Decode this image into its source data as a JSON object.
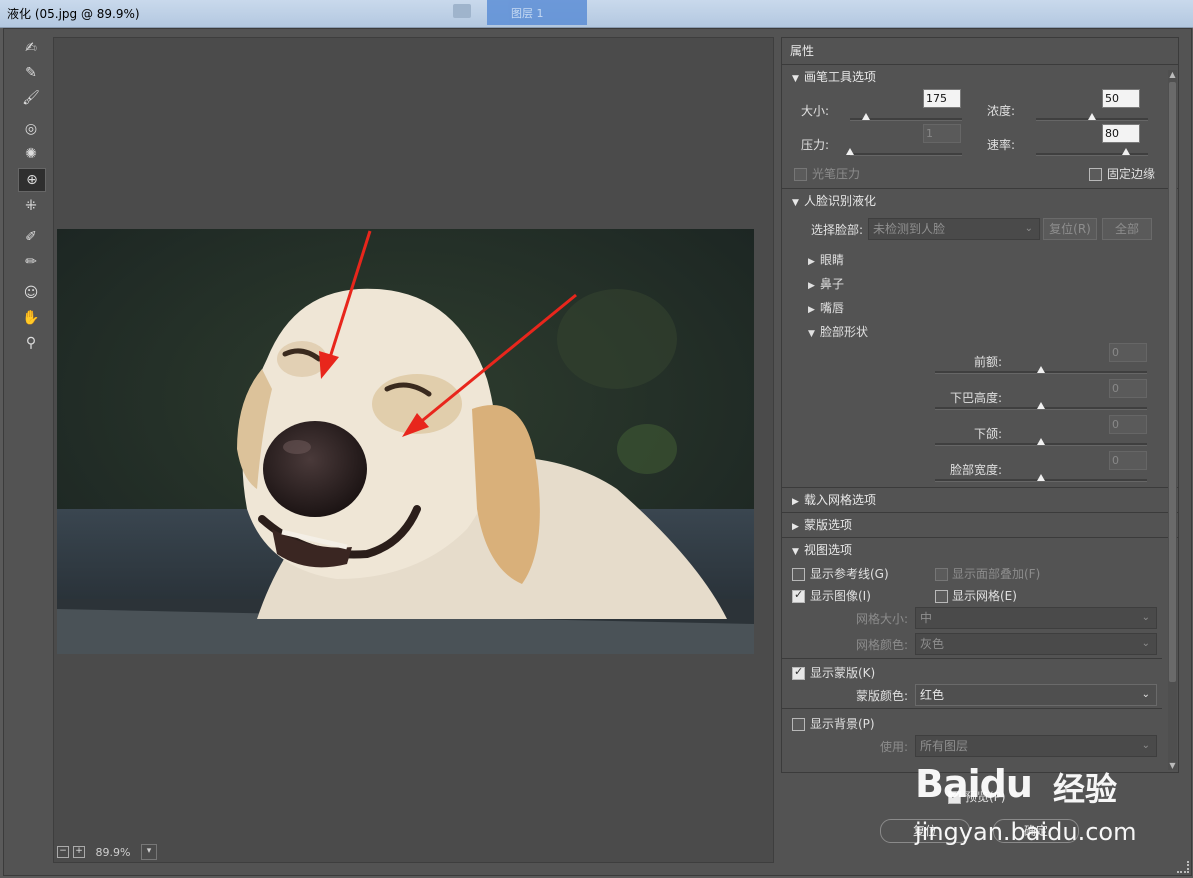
{
  "window": {
    "title": "液化 (05.jpg @ 89.9%)",
    "taskbar_hint": "图层 1"
  },
  "toolbar": {
    "icons": [
      "forward-warp-icon",
      "reconstruct-icon",
      "smooth-icon",
      "twirl-icon",
      "pucker-icon",
      "bloat-icon",
      "push-left-icon",
      "freeze-mask-icon",
      "thaw-mask-icon",
      "face-tool-icon",
      "hand-icon",
      "zoom-icon"
    ],
    "active": "bloat-icon"
  },
  "canvas": {
    "zoom": "89.9%",
    "zoom_out": "−",
    "zoom_in": "+"
  },
  "properties": {
    "header": "属性",
    "brush": {
      "title": "画笔工具选项",
      "size_label": "大小:",
      "size_value": "175",
      "size_level": 0.14,
      "density_label": "浓度:",
      "density_value": "50",
      "density_level": 0.5,
      "pressure_label": "压力:",
      "pressure_value": "1",
      "pressure_level": 0.0,
      "rate_label": "速率:",
      "rate_value": "80",
      "rate_level": 0.8,
      "stylus_label": "光笔压力",
      "pin_edges_label": "固定边缘"
    },
    "face": {
      "title": "人脸识别液化",
      "select_face_label": "选择脸部:",
      "select_face_value": "未检测到人脸",
      "reset_label": "复位(R)",
      "all_label": "全部",
      "eyes": "眼睛",
      "nose": "鼻子",
      "mouth": "嘴唇",
      "face_shape": "脸部形状",
      "forehead_label": "前额:",
      "forehead_value": "0",
      "chin_height_label": "下巴高度:",
      "chin_height_value": "0",
      "jawline_label": "下颌:",
      "jawline_value": "0",
      "face_width_label": "脸部宽度:",
      "face_width_value": "0"
    },
    "load_mesh": "载入网格选项",
    "mask_options": "蒙版选项",
    "view": {
      "title": "视图选项",
      "show_guides": "显示参考线(G)",
      "show_face_overlay": "显示面部叠加(F)",
      "show_image": "显示图像(I)",
      "show_mesh": "显示网格(E)",
      "mesh_size_label": "网格大小:",
      "mesh_size_value": "中",
      "mesh_color_label": "网格颜色:",
      "mesh_color_value": "灰色",
      "show_mask": "显示蒙版(K)",
      "mask_color_label": "蒙版颜色:",
      "mask_color_value": "红色",
      "show_backdrop": "显示背景(P)",
      "use_label": "使用:",
      "use_value": "所有图层"
    }
  },
  "bottom": {
    "preview_label": "预览(P)",
    "reset_button": "复位",
    "ok_button": "确定"
  },
  "watermark": {
    "brand": "Baidu",
    "suffix": "经验",
    "url": "jingyan.baidu.com"
  },
  "colors": {
    "panel": "#535353",
    "arrow": "#e8261c"
  }
}
